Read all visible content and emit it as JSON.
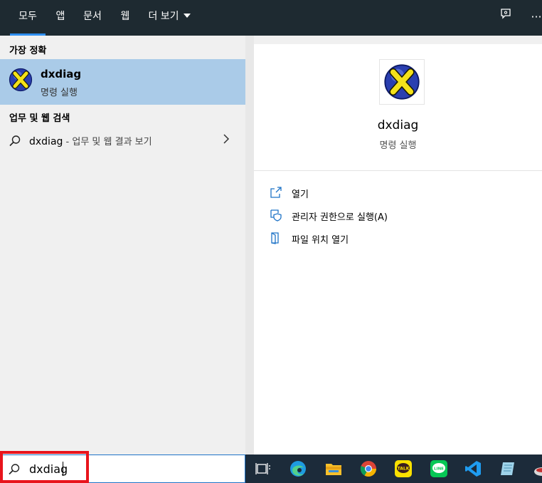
{
  "tabs": [
    {
      "label": "모두",
      "active": true
    },
    {
      "label": "앱",
      "active": false
    },
    {
      "label": "문서",
      "active": false
    },
    {
      "label": "웹",
      "active": false
    },
    {
      "label": "더 보기",
      "active": false
    }
  ],
  "top_icons": [
    "feedback-icon",
    "more-options-icon"
  ],
  "more_glyph": "···",
  "left": {
    "best_match_title": "가장 정확",
    "best_match": {
      "name": "dxdiag",
      "subtitle": "명령 실행"
    },
    "web_title": "업무 및 웹 검색",
    "web_query": "dxdiag",
    "web_suffix": " - 업무 및 웹 결과 보기"
  },
  "right": {
    "name": "dxdiag",
    "subtitle": "명령 실행",
    "actions": [
      {
        "label": "열기",
        "icon": "open-icon"
      },
      {
        "label": "관리자 권한으로 실행(A)",
        "icon": "admin-shield-icon"
      },
      {
        "label": "파일 위치 열기",
        "icon": "file-location-icon"
      }
    ]
  },
  "search": {
    "value": "dxdiag"
  },
  "taskbar": [
    "task-view-icon",
    "edge-icon",
    "file-explorer-icon",
    "chrome-icon",
    "kakaotalk-icon",
    "line-icon",
    "vscode-icon",
    "notepad-icon",
    "app-icon"
  ],
  "colors": {
    "accent": "#2e8ef0",
    "selected": "#aacbe8",
    "highlight_box": "#e8141c",
    "topbar": "#1e2a31",
    "taskbar": "#1c2b3a"
  }
}
